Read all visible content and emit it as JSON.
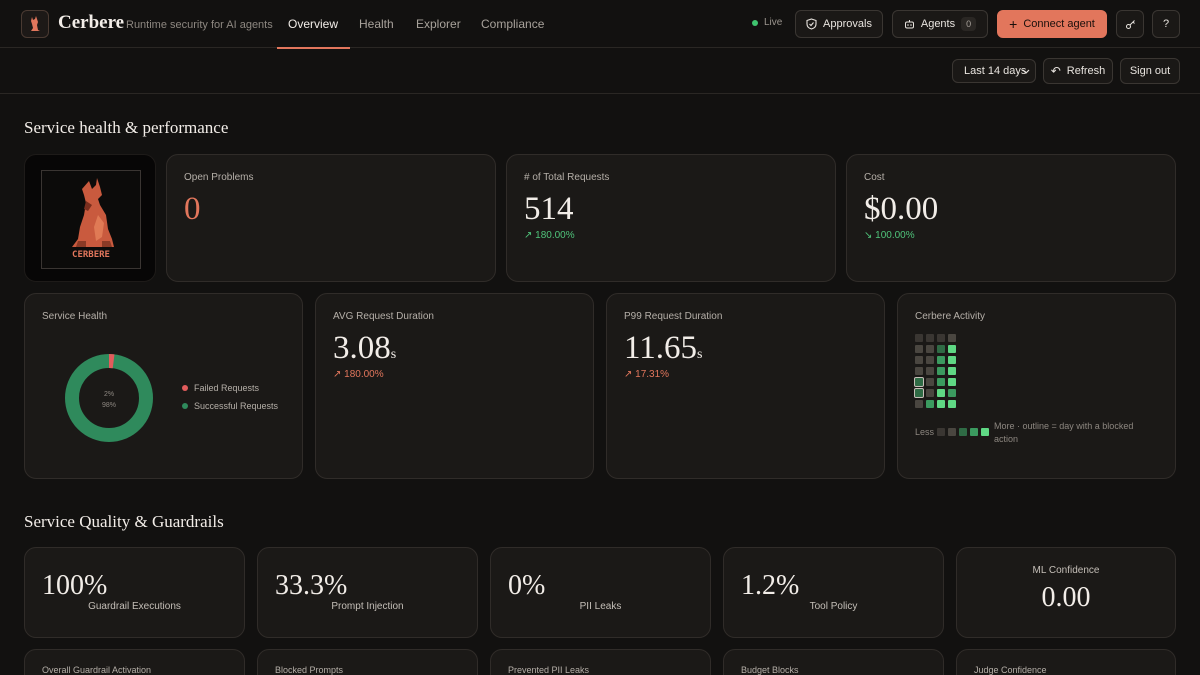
{
  "brand": {
    "name": "Cerbere",
    "tagline": "Runtime security for AI agents",
    "logo_text": "CERBERE"
  },
  "nav": {
    "tabs": [
      {
        "label": "Overview",
        "active": true
      },
      {
        "label": "Health",
        "active": false
      },
      {
        "label": "Explorer",
        "active": false
      },
      {
        "label": "Compliance",
        "active": false
      }
    ]
  },
  "header": {
    "live_label": "Live",
    "approvals_label": "Approvals",
    "agents_label": "Agents",
    "agents_count": "0",
    "connect_label": "Connect agent",
    "help_label": "?"
  },
  "toolbar": {
    "range_label": "Last 14 days",
    "refresh_label": "Refresh",
    "signout_label": "Sign out"
  },
  "sections": {
    "health_title": "Service health & performance",
    "quality_title": "Service Quality & Guardrails"
  },
  "metrics": {
    "open_problems": {
      "label": "Open Problems",
      "value": "0"
    },
    "total_requests": {
      "label": "# of Total Requests",
      "value": "514",
      "delta": "↗ 180.00%"
    },
    "cost": {
      "label": "Cost",
      "value": "$0.00",
      "delta": "↘ 100.00%"
    },
    "service_health": {
      "label": "Service Health",
      "failed_pct": "2%",
      "success_pct": "98%",
      "failed_label": "Failed Requests",
      "success_label": "Successful Requests",
      "failed_fraction": 0.02
    },
    "avg_duration": {
      "label": "AVG Request Duration",
      "value": "3.08",
      "unit": "s",
      "delta": "↗ 180.00%"
    },
    "p99_duration": {
      "label": "P99 Request Duration",
      "value": "11.65",
      "unit": "s",
      "delta": "↗ 17.31%"
    },
    "activity": {
      "label": "Cerbere Activity",
      "less_label": "Less",
      "more_label": "More · outline = day with a blocked action"
    }
  },
  "quality": [
    {
      "value": "100%",
      "label": "Guardrail Executions"
    },
    {
      "value": "33.3%",
      "label": "Prompt Injection"
    },
    {
      "value": "0%",
      "label": "PII Leaks"
    },
    {
      "value": "1.2%",
      "label": "Tool Policy"
    },
    {
      "value": "0.00",
      "label": "ML Confidence"
    }
  ],
  "bottom_labels": [
    "Overall Guardrail Activation",
    "Blocked Prompts",
    "Prevented PII Leaks",
    "Budget Blocks",
    "Judge Confidence"
  ],
  "colors": {
    "accent": "#e2765c",
    "success": "#3b8c5f",
    "failed": "#e25c5c",
    "positive_delta": "#4fc37a"
  }
}
